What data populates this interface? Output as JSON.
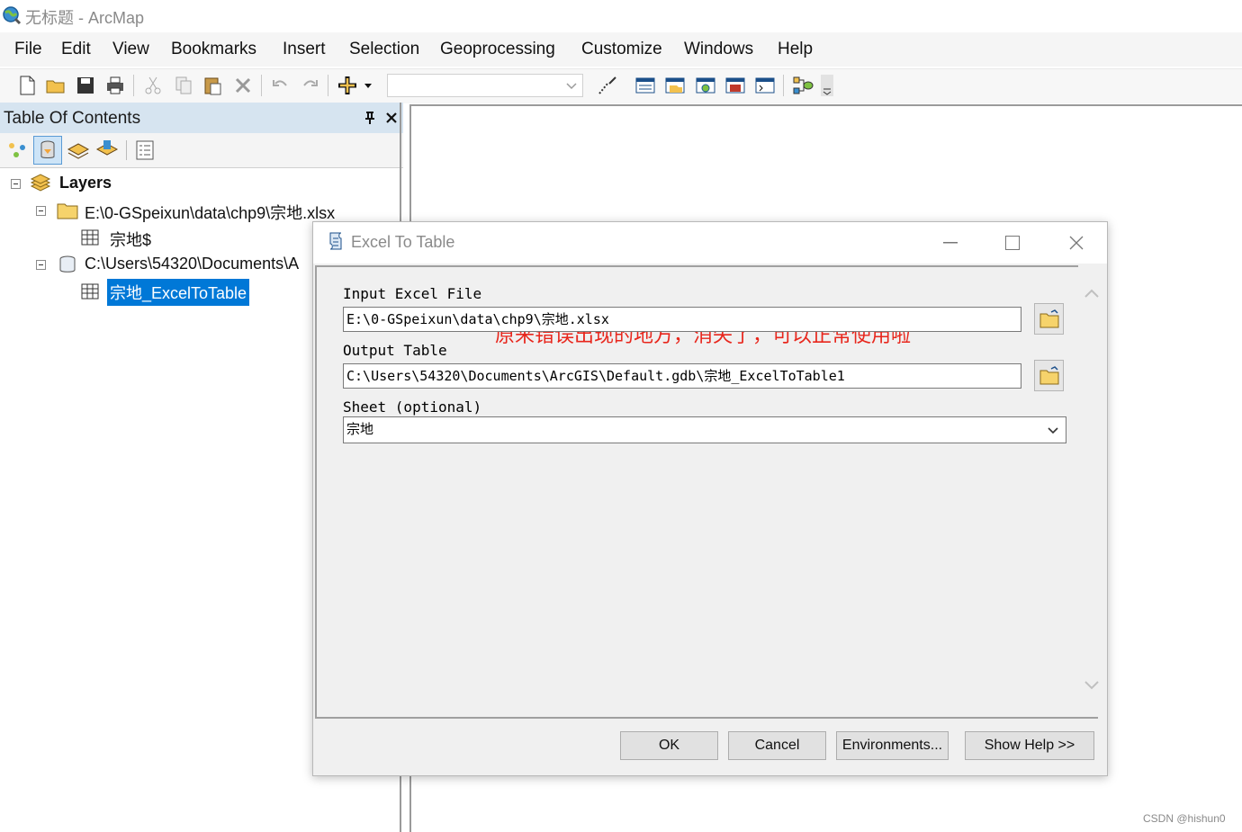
{
  "window": {
    "title": "无标题 - ArcMap"
  },
  "menu": [
    "File",
    "Edit",
    "View",
    "Bookmarks",
    "Insert",
    "Selection",
    "Geoprocessing",
    "Customize",
    "Windows",
    "Help"
  ],
  "toc": {
    "title": "Table Of Contents",
    "tree": {
      "root": "Layers",
      "items": [
        {
          "label": "E:\\0-GSpeixun\\data\\chp9\\宗地.xlsx",
          "children": [
            "宗地$"
          ]
        },
        {
          "label": "C:\\Users\\54320\\Documents\\A",
          "children": [
            "宗地_ExcelToTable"
          ]
        }
      ]
    }
  },
  "dialog": {
    "title": "Excel To Table",
    "annotation": "原来错误出现的地方，消失了，可以正常使用啦",
    "params": {
      "input_label": "Input Excel File",
      "input_value": "E:\\0-GSpeixun\\data\\chp9\\宗地.xlsx",
      "output_label": "Output Table",
      "output_value": "C:\\Users\\54320\\Documents\\ArcGIS\\Default.gdb\\宗地_ExcelToTable1",
      "sheet_label": "Sheet (optional)",
      "sheet_value": "宗地"
    },
    "buttons": {
      "ok": "OK",
      "cancel": "Cancel",
      "env": "Environments...",
      "help": "Show Help >>"
    }
  },
  "watermark": "CSDN @hishun0",
  "colors": {
    "annotation": "#e8261c",
    "selection": "#0078d7",
    "toc_header": "#d6e4f0"
  }
}
